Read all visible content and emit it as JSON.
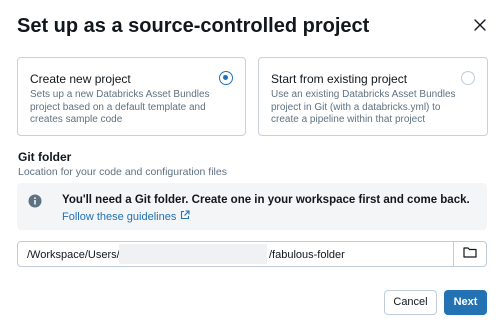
{
  "dialog": {
    "title": "Set up as a source-controlled project",
    "close_icon": "close-icon"
  },
  "options": [
    {
      "title": "Create new project",
      "description": "Sets up a new Databricks Asset Bundles project based on a default template and creates sample code",
      "selected": true
    },
    {
      "title": "Start from existing project",
      "description": "Use an existing Databricks Asset Bundles project in Git (with a databricks.yml) to create a pipeline within that project",
      "selected": false
    }
  ],
  "git_folder": {
    "label": "Git folder",
    "hint": "Location for your code and configuration files",
    "alert": {
      "icon": "info-icon",
      "message": "You'll need a Git folder. Create one in your workspace first and come back.",
      "link": "Follow these guidelines",
      "link_icon": "external-link-icon"
    },
    "path": {
      "prefix": "/Workspace/Users/",
      "suffix": "/fabulous-folder"
    },
    "browse_icon": "folder-icon"
  },
  "footer": {
    "cancel_label": "Cancel",
    "next_label": "Next"
  },
  "colors": {
    "accent": "#2272b4",
    "text": "#11171c",
    "muted": "#5f7281",
    "border": "#c0cdd8",
    "alert_bg": "#f3f5f7"
  }
}
